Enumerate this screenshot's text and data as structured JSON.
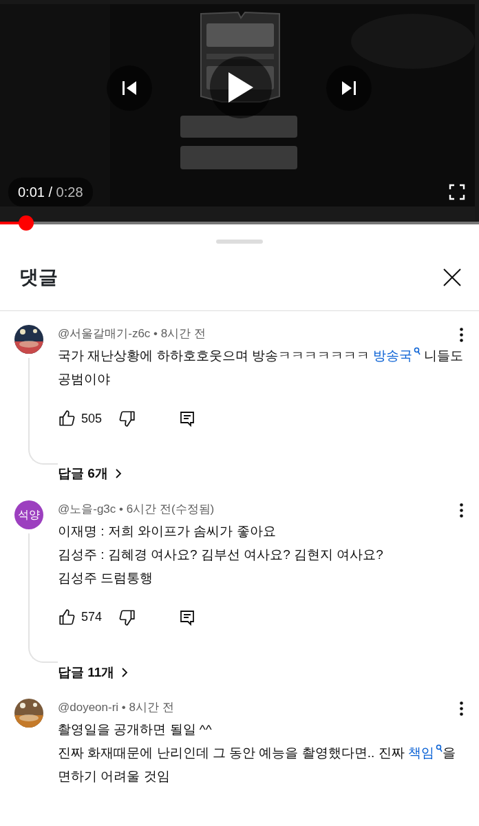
{
  "video": {
    "kind": "picture",
    "current_time": "0:01",
    "separator": "/",
    "duration": "0:28",
    "level": 0.054
  },
  "sheet": {
    "title": "댓글"
  },
  "comments": [
    {
      "avatar": {
        "kind": "picture"
      },
      "author": "@서울갈매기-z6c",
      "separator": "•",
      "time": "8시간 전",
      "paragraphs": [
        [
          {
            "kind": "text",
            "text": "국가 재난상황에 하하호호웃으며 방송ㅋㅋㅋㅋㅋㅋㅋ "
          },
          {
            "kind": "link",
            "text": "방송국"
          },
          {
            "kind": "text",
            "text": " 니들도 공범이야"
          }
        ]
      ],
      "likes": "505",
      "replies": "답글 6개"
    },
    {
      "avatar": {
        "kind": "initials",
        "text": "석양"
      },
      "author": "@노을-g3c",
      "separator": "•",
      "time": "6시간 전(수정됨)",
      "paragraphs": [
        [
          {
            "kind": "text",
            "text": "이재명 : 저희 와이프가 솜씨가 좋아요"
          }
        ],
        [
          {
            "kind": "text",
            "text": "김성주 : 김혜경 여사요? 김부선 여사요? 김현지 여사요?"
          }
        ],
        [
          {
            "kind": "text",
            "text": "김성주 드럼통행"
          }
        ]
      ],
      "likes": "574",
      "replies": "답글 11개"
    },
    {
      "avatar": {
        "kind": "picture"
      },
      "author": "@doyeon-ri",
      "separator": "•",
      "time": "8시간 전",
      "paragraphs": [
        [
          {
            "kind": "text",
            "text": "촬영일을 공개하면 될일 ^^"
          }
        ],
        [
          {
            "kind": "text",
            "text": "진짜 화재때문에 난리인데 그 동안 예능을 촬영했다면.. 진짜 "
          },
          {
            "kind": "link",
            "text": "책임"
          },
          {
            "kind": "text",
            "text": "을 면하기 어려울 것임"
          }
        ]
      ]
    }
  ]
}
